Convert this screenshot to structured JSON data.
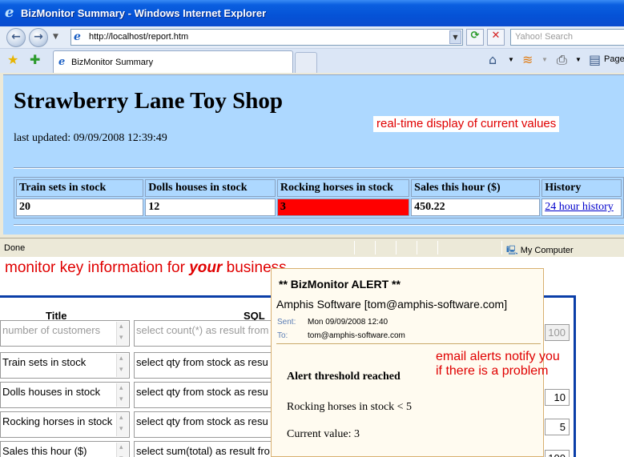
{
  "window": {
    "title": "BizMonitor Summary - Windows Internet Explorer",
    "url": "http://localhost/report.htm",
    "search_placeholder": "Yahoo! Search",
    "tab_label": "BizMonitor Summary",
    "toolbar_page_label": "Page",
    "status_text": "Done",
    "status_zone": "My Computer"
  },
  "page": {
    "shop_title": "Strawberry Lane Toy Shop",
    "last_updated": "last updated: 09/09/2008 12:39:49",
    "annotation": "real-time display of current values",
    "table": {
      "headers": [
        "Train sets in stock",
        "Dolls houses in stock",
        "Rocking horses in stock",
        "Sales this hour ($)",
        "History"
      ],
      "values": [
        "20",
        "12",
        "3",
        "450.22"
      ],
      "history_link": "24 hour history",
      "alert_color": "#ff0000"
    }
  },
  "annotations": {
    "monitor_prefix": "monitor key information for ",
    "monitor_emphasis": "your",
    "monitor_suffix": " business",
    "email_line1": "email alerts notify you",
    "email_line2": "if there is a problem",
    "color": "#e00000"
  },
  "config": {
    "col_title": "Title",
    "col_sql": "SQL",
    "rows": [
      {
        "title": "number of customers",
        "sql": "select count(*) as result from",
        "threshold": "100"
      },
      {
        "title": "Train sets in stock",
        "sql": "select qty from stock as resu",
        "threshold": ""
      },
      {
        "title": "Dolls houses in stock",
        "sql": "select qty from stock as resu",
        "threshold": "10"
      },
      {
        "title": "Rocking horses in stock",
        "sql": "select qty from stock as resu",
        "threshold": "5"
      },
      {
        "title": "Sales this hour ($)",
        "sql": "select sum(total) as result fro",
        "threshold": "100"
      }
    ]
  },
  "email": {
    "subject": "** BizMonitor ALERT **",
    "sender": "Amphis Software [tom@amphis-software.com]",
    "sent_label": "Sent:",
    "sent_value": "Mon 09/09/2008 12:40",
    "to_label": "To:",
    "to_value": "tom@amphis-software.com",
    "body_heading": "Alert threshold reached",
    "body_condition": "Rocking horses in stock < 5",
    "body_current": "Current value: 3"
  },
  "icons": {
    "back": "back-arrow-icon",
    "forward": "forward-arrow-icon",
    "refresh": "refresh-icon",
    "stop": "stop-icon",
    "favorites": "favorites-star-icon",
    "add_favorites": "add-favorites-icon",
    "home": "home-icon",
    "feeds": "feeds-icon",
    "print": "print-icon",
    "page": "page-icon",
    "computer": "my-computer-icon"
  }
}
